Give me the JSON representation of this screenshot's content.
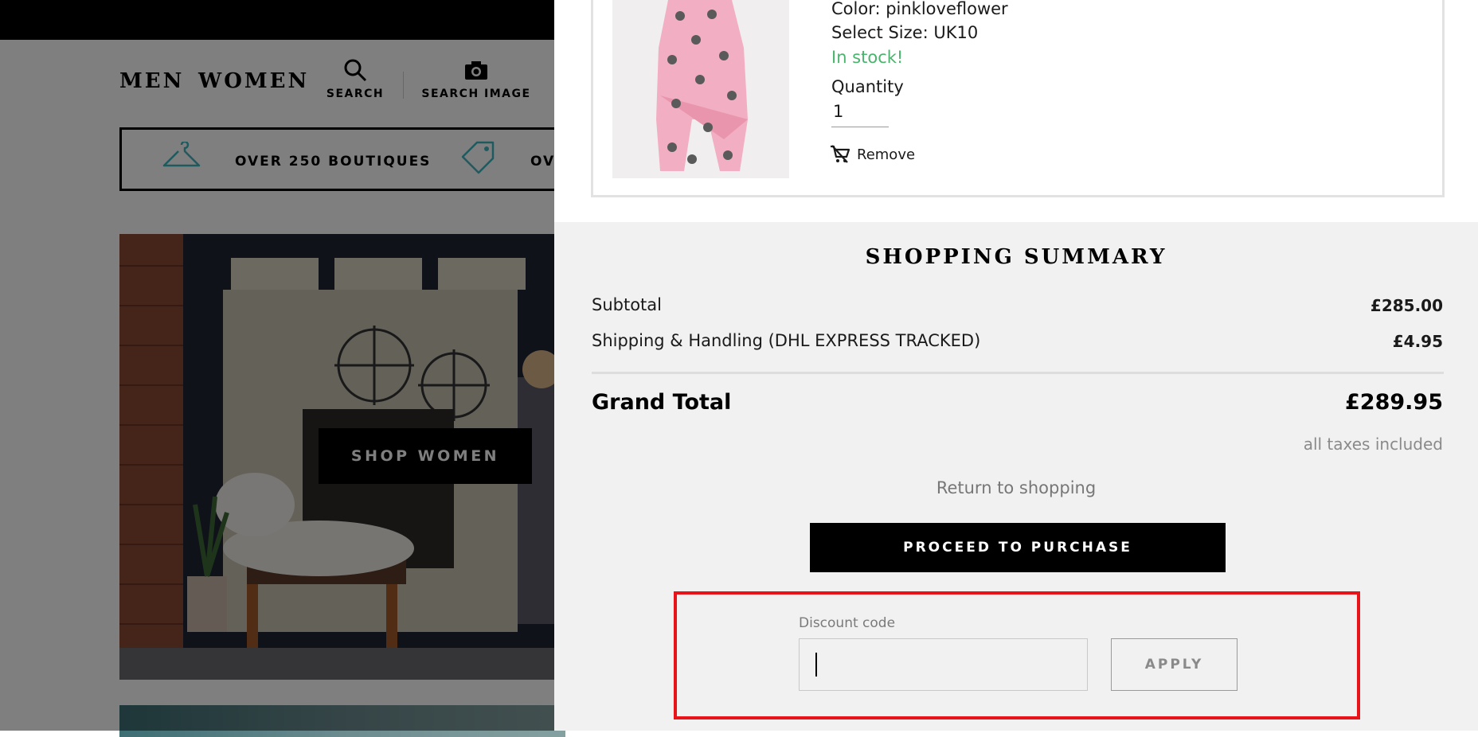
{
  "background_page": {
    "nav": {
      "men": "MEN",
      "women": "WOMEN"
    },
    "tools": {
      "search": "SEARCH",
      "search_image": "SEARCH IMAGE"
    },
    "usps": [
      "OVER 250 BOUTIQUES",
      "OVI"
    ],
    "hero": {
      "shop_women": "SHOP WOMEN"
    }
  },
  "cart_item": {
    "color": "Color: pinkloveflower",
    "size": "Select Size: UK10",
    "stock": "In stock!",
    "quantity_label": "Quantity",
    "quantity_value": "1",
    "remove_label": "Remove"
  },
  "summary": {
    "title": "SHOPPING SUMMARY",
    "subtotal_label": "Subtotal",
    "subtotal_value": "£285.00",
    "shipping_label": "Shipping & Handling (DHL EXPRESS TRACKED)",
    "shipping_value": "£4.95",
    "grand_total_label": "Grand Total",
    "grand_total_value": "£289.95",
    "taxes_note": "all taxes included",
    "return_link": "Return to shopping",
    "proceed_button": "PROCEED TO PURCHASE"
  },
  "discount": {
    "label": "Discount code",
    "value": "",
    "apply_button": "APPLY"
  },
  "colors": {
    "in_stock": "#4bb36d",
    "highlight": "#e8141a",
    "summary_bg": "#f1f1f1",
    "primary_button": "#000000"
  }
}
